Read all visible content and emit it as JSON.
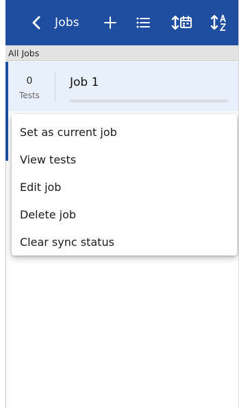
{
  "header": {
    "title": "Jobs",
    "icons": [
      "chevron-left-icon",
      "plus-icon",
      "list-icon",
      "sort-by-date-icon",
      "sort-a-z-icon"
    ]
  },
  "section": {
    "label": "All Jobs"
  },
  "job": {
    "test_count": "0",
    "test_count_label": "Tests",
    "name": "Job 1",
    "progress_fraction": 0
  },
  "context_menu": {
    "items": [
      {
        "label": "Set as current job"
      },
      {
        "label": "View tests"
      },
      {
        "label": "Edit job"
      },
      {
        "label": "Delete job"
      },
      {
        "label": "Clear sync status"
      }
    ]
  },
  "colors": {
    "header_bg": "#1f4ea1",
    "selected_row_bg": "#e8f1fb",
    "section_header_bg": "#e3e3e3"
  }
}
